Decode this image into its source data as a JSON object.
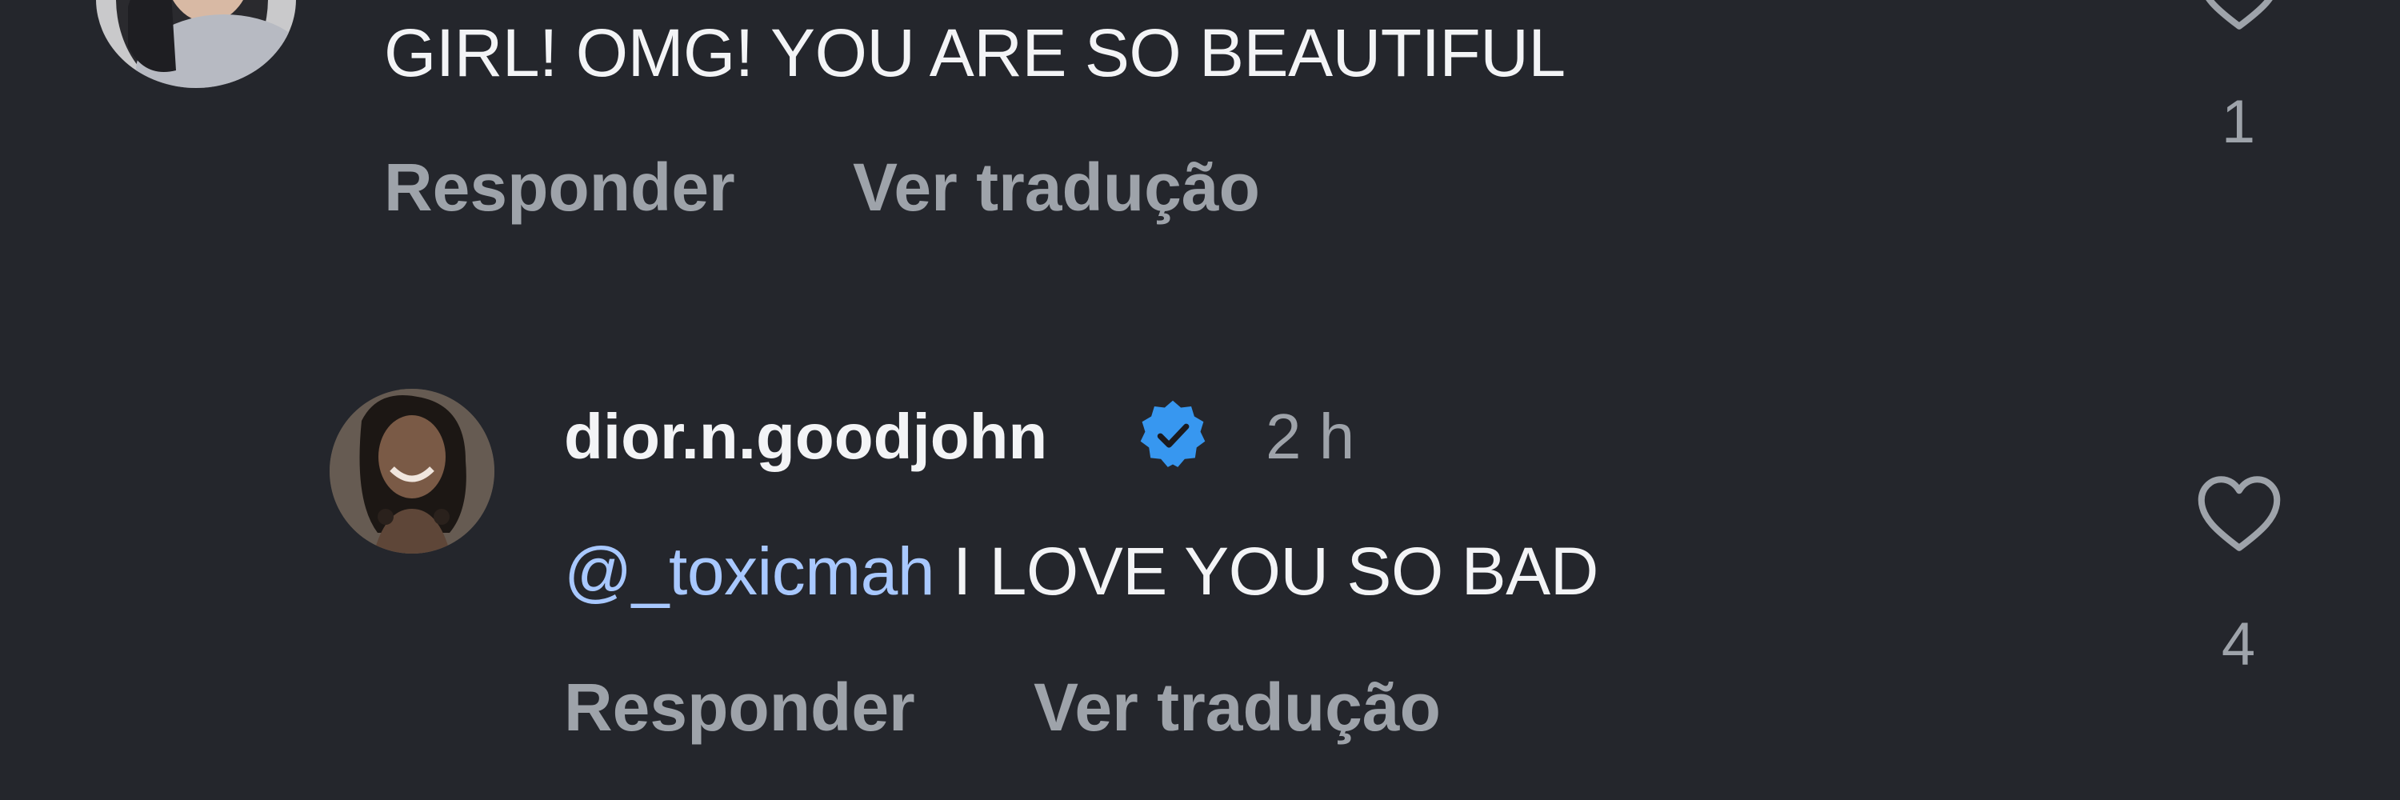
{
  "comment_top": {
    "text": "GIRL! OMG! YOU ARE SO BEAUTIFUL",
    "reply_label": "Responder",
    "translate_label": "Ver tradução",
    "like_count": "1",
    "like_icon": "heart-outline-icon"
  },
  "comment_reply": {
    "username": "dior.n.goodjohn",
    "verified_icon": "verified-badge-icon",
    "timestamp": "2 h",
    "mention": "@_toxicmah",
    "text": " I LOVE YOU SO BAD",
    "reply_label": "Responder",
    "translate_label": "Ver tradução",
    "like_count": "4",
    "like_icon": "heart-outline-icon"
  },
  "colors": {
    "background": "#24262c",
    "text_primary": "#f3f4f6",
    "text_secondary": "#9ea3aa",
    "mention": "#a8c8ff",
    "verified": "#3797f0"
  }
}
